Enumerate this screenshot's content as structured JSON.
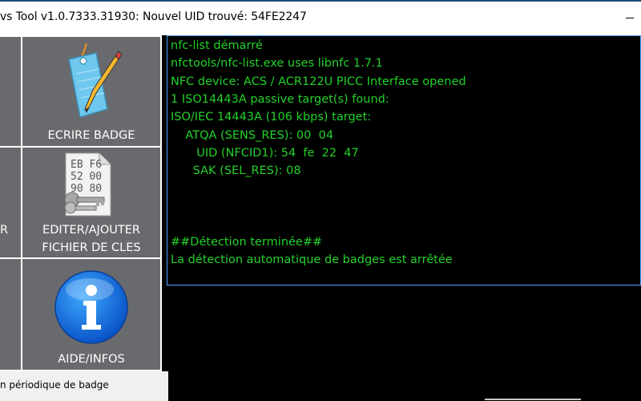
{
  "window": {
    "title": "vs Tool v1.0.7333.31930: Nouvel UID trouvé: 54FE2247"
  },
  "tiles": {
    "write_badge": {
      "label": "ECRIRE BADGE",
      "icon": "tag-pencil-icon"
    },
    "edit_keys": {
      "label_line1": "EDITER/AJOUTER",
      "label_line2": "FICHIER DE CLES",
      "icon": "keys-file-icon"
    },
    "help": {
      "label": "AIDE/INFOS",
      "icon": "info-icon"
    },
    "left_partial_mid": {
      "label": "R"
    }
  },
  "console": {
    "lines": [
      "nfc-list démarré",
      "nfctools/nfc-list.exe uses libnfc 1.7.1",
      "NFC device: ACS / ACR122U PICC Interface opened",
      "1 ISO14443A passive target(s) found:",
      "ISO/IEC 14443A (106 kbps) target:",
      "    ATQA (SENS_RES): 00  04",
      "       UID (NFCID1): 54  fe  22  47",
      "      SAK (SEL_RES): 08",
      "",
      "",
      "",
      "##Détection terminée##",
      "La détection automatique de badges est arrêtée"
    ]
  },
  "status": {
    "text": "n périodique de badge"
  },
  "colors": {
    "console_text": "#24d12a",
    "console_bg": "#000000",
    "tile_bg": "#696a6d",
    "console_border": "#4aa3ff"
  }
}
